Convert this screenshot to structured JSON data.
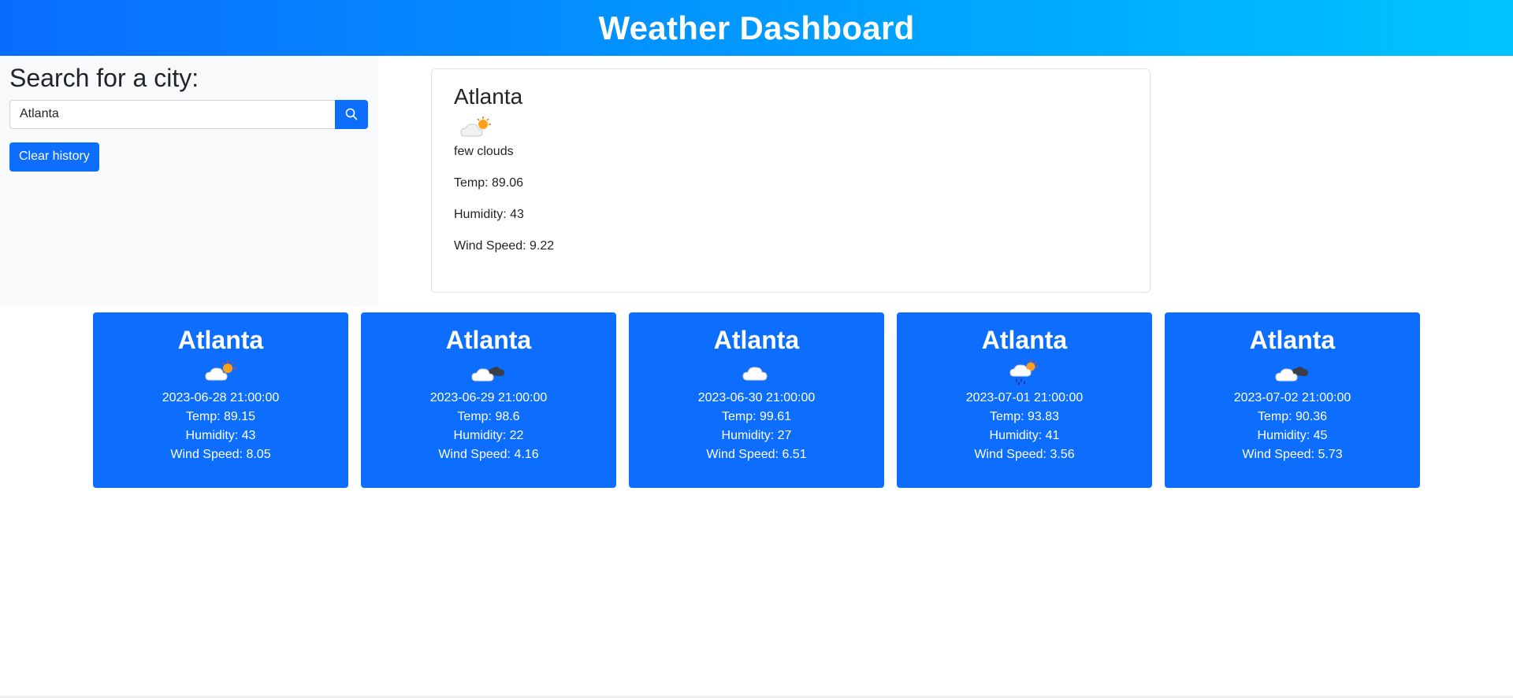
{
  "header": {
    "title": "Weather Dashboard"
  },
  "sidebar": {
    "heading": "Search for a city:",
    "search": {
      "value": "Atlanta",
      "placeholder": ""
    },
    "search_button_icon": "search-icon",
    "clear_label": "Clear history"
  },
  "current": {
    "city": "Atlanta",
    "icon": "few-clouds-icon",
    "description": "few clouds",
    "temp": "Temp: 89.06",
    "humidity": "Humidity: 43",
    "wind": "Wind Speed: 9.22"
  },
  "forecast": [
    {
      "city": "Atlanta",
      "icon": "few-clouds-icon",
      "date": "2023-06-28 21:00:00",
      "temp": "Temp: 89.15",
      "humidity": "Humidity: 43",
      "wind": "Wind Speed: 8.05"
    },
    {
      "city": "Atlanta",
      "icon": "broken-clouds-icon",
      "date": "2023-06-29 21:00:00",
      "temp": "Temp: 98.6",
      "humidity": "Humidity: 22",
      "wind": "Wind Speed: 4.16"
    },
    {
      "city": "Atlanta",
      "icon": "scattered-clouds-icon",
      "date": "2023-06-30 21:00:00",
      "temp": "Temp: 99.61",
      "humidity": "Humidity: 27",
      "wind": "Wind Speed: 6.51"
    },
    {
      "city": "Atlanta",
      "icon": "rain-icon",
      "date": "2023-07-01 21:00:00",
      "temp": "Temp: 93.83",
      "humidity": "Humidity: 41",
      "wind": "Wind Speed: 3.56"
    },
    {
      "city": "Atlanta",
      "icon": "broken-clouds-icon",
      "date": "2023-07-02 21:00:00",
      "temp": "Temp: 90.36",
      "humidity": "Humidity: 45",
      "wind": "Wind Speed: 5.73"
    }
  ],
  "colors": {
    "accent": "#0d6efd",
    "header_start": "#0a6cff",
    "header_end": "#00c4ff",
    "sidebar_bg": "#f8f9fa"
  }
}
